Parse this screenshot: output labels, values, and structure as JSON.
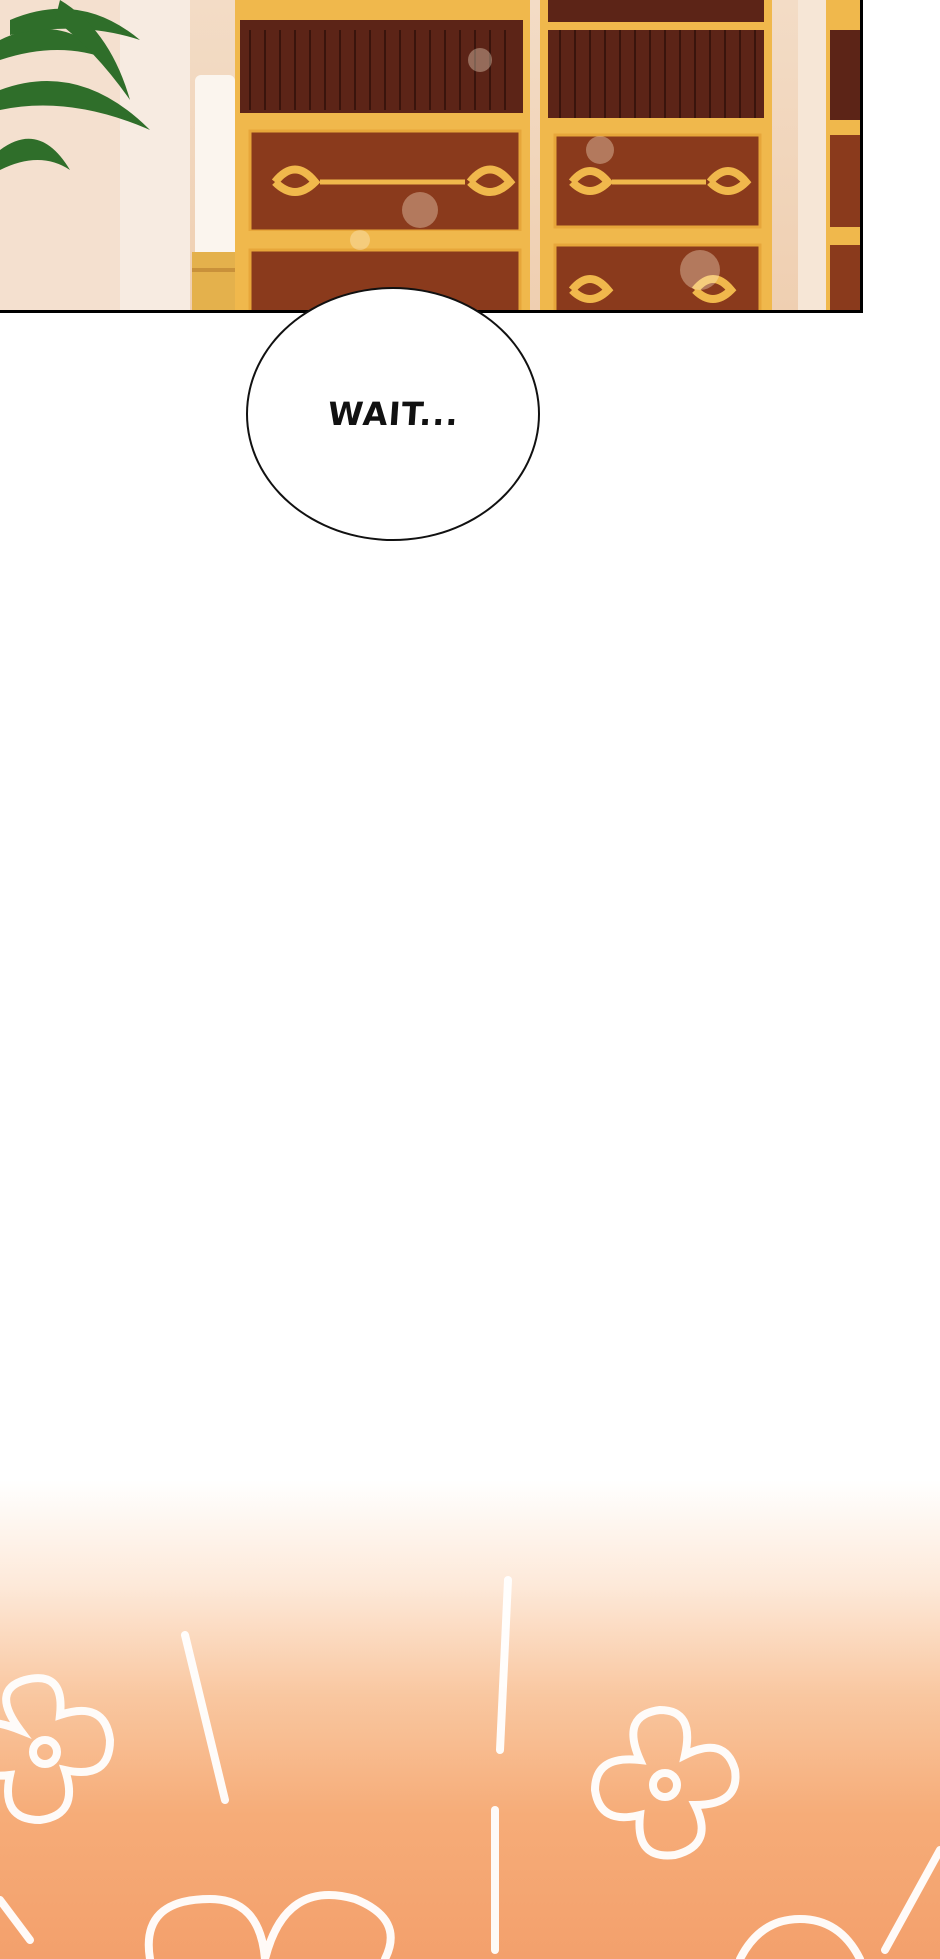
{
  "comic": {
    "speech_bubble": {
      "text": "WAIT..."
    },
    "top_panel": {
      "scene": "library-bookshelves"
    },
    "bottom_effect": {
      "scene": "sparkle-glow"
    }
  },
  "colors": {
    "shelf_wood": "#8a3a1c",
    "shelf_trim": "#e7a63a",
    "wall": "#f3dcc6",
    "glow": "#f3a06c"
  }
}
